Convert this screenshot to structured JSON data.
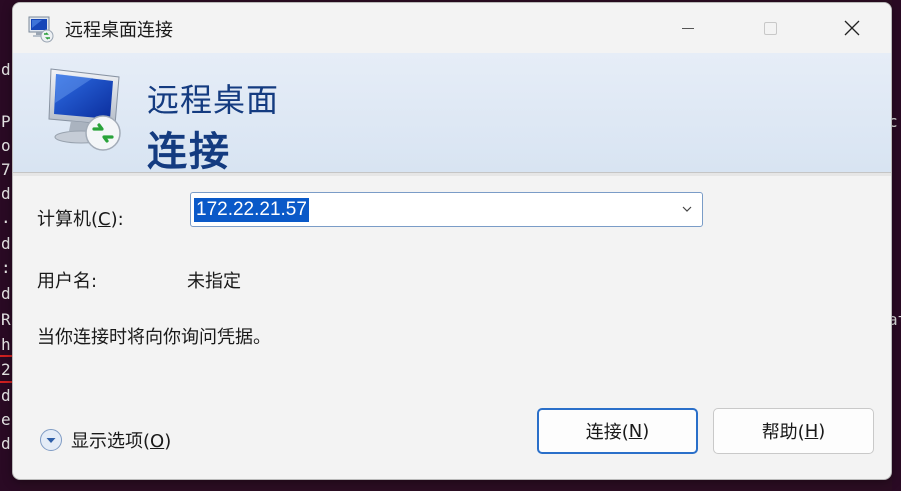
{
  "background_terminal": {
    "chars": [
      "d",
      "P",
      "o",
      "7",
      "d",
      ".",
      "d",
      ":",
      "d",
      "R",
      "h",
      "2",
      "d",
      "e",
      "d"
    ],
    "right_chars": [
      "c",
      "at"
    ]
  },
  "window": {
    "title": "远程桌面连接"
  },
  "banner": {
    "line1": "远程桌面",
    "line2": "连接"
  },
  "form": {
    "computer_label": "计算机(",
    "computer_hotkey": "C",
    "computer_label_end": "):",
    "computer_value": "172.22.21.57",
    "user_label": "用户名:",
    "user_value": "未指定",
    "note": "当你连接时将向你询问凭据。"
  },
  "options": {
    "label": "显示选项(",
    "hotkey": "O",
    "label_end": ")"
  },
  "buttons": {
    "connect_label": "连接(",
    "connect_hotkey": "N",
    "connect_end": ")",
    "help_label": "帮助(",
    "help_hotkey": "H",
    "help_end": ")"
  },
  "colors": {
    "accent": "#0a59c8",
    "banner_text": "#143b80",
    "focus_border": "#2a6fc9"
  }
}
